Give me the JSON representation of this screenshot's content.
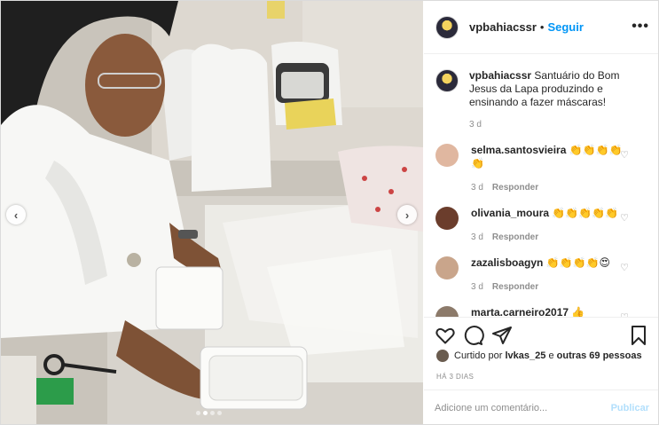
{
  "header": {
    "username": "vpbahiacssr",
    "separator": "•",
    "follow_label": "Seguir",
    "more_label": "•••"
  },
  "caption": {
    "username": "vpbahiacssr",
    "text": "Santuário do Bom Jesus da Lapa produzindo e ensinando a fazer máscaras!",
    "time": "3 d"
  },
  "comments": [
    {
      "username": "selma.santosvieira",
      "text": "👏👏👏👏👏",
      "time": "3 d",
      "reply_label": "Responder"
    },
    {
      "username": "olivania_moura",
      "text": "👏👏👏👏👏",
      "time": "3 d",
      "reply_label": "Responder"
    },
    {
      "username": "zazalisboagyn",
      "text": "👏👏👏👏😍",
      "time": "3 d",
      "reply_label": "Responder"
    },
    {
      "username": "marta.carneiro2017",
      "text": "👍",
      "time": "",
      "reply_label": ""
    }
  ],
  "likes": {
    "prefix": "Curtido por",
    "user": "lvkas_25",
    "middle": "e",
    "others": "outras 69 pessoas"
  },
  "post_time": "HÁ 3 DIAS",
  "add_comment": {
    "placeholder": "Adicione um comentário...",
    "publish_label": "Publicar"
  },
  "carousel": {
    "prev_label": "‹",
    "next_label": "›",
    "dot_count": 4,
    "active_index": 1
  },
  "heart_glyph": "♡"
}
